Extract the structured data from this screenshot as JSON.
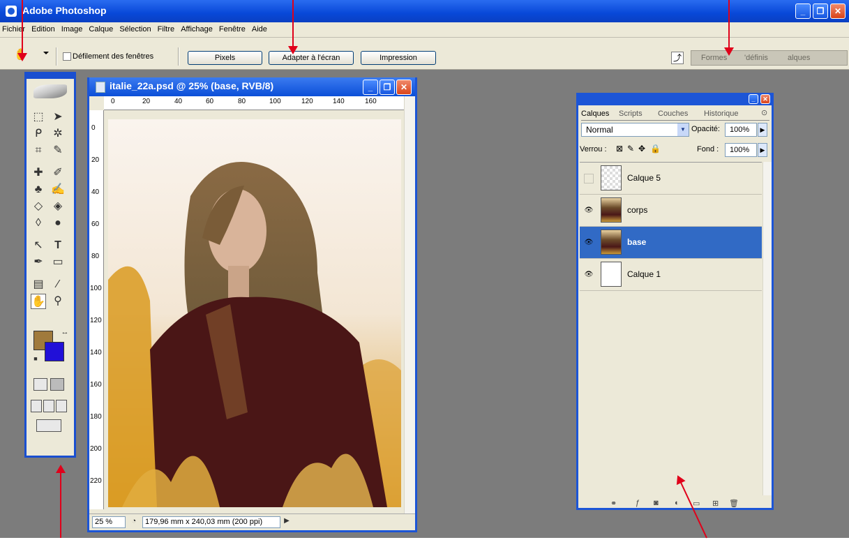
{
  "titlebar": {
    "title": "Adobe Photoshop"
  },
  "menu": [
    "Fichier",
    "Edition",
    "Image",
    "Calque",
    "Sélection",
    "Filtre",
    "Affichage",
    "Fenêtre",
    "Aide"
  ],
  "options": {
    "scroll_all_label": "Défilement des fenêtres",
    "btn_pixels": "Pixels",
    "btn_fit": "Adapter à l'écran",
    "btn_print": "Impression"
  },
  "palette_well": {
    "tabs": [
      "Formes",
      "'définis",
      "alques"
    ]
  },
  "document": {
    "title": "italie_22a.psd @ 25% (base, RVB/8)",
    "ruler_top": [
      "0",
      "20",
      "40",
      "60",
      "80",
      "100",
      "120",
      "140",
      "160"
    ],
    "ruler_left": [
      "0",
      "20",
      "40",
      "60",
      "80",
      "100",
      "120",
      "140",
      "160",
      "180",
      "200",
      "220"
    ],
    "zoom": "25 %",
    "status": "179,96 mm x 240,03 mm (200 ppi)"
  },
  "layers_panel": {
    "tabs": [
      "Calques",
      "Scripts",
      "Couches",
      "Historique"
    ],
    "blend_mode": "Normal",
    "opacity_label": "Opacité:",
    "opacity_value": "100%",
    "lock_label": "Verrou :",
    "fill_label": "Fond :",
    "fill_value": "100%",
    "layers": [
      {
        "name": "Calque 5",
        "visible": false,
        "thumb": "transparent"
      },
      {
        "name": "corps",
        "visible": true,
        "thumb": "person"
      },
      {
        "name": "base",
        "visible": true,
        "thumb": "person",
        "selected": true
      },
      {
        "name": "Calque 1",
        "visible": true,
        "thumb": "white"
      }
    ]
  },
  "colors": {
    "foreground": "#a07a3c",
    "background": "#2110d8",
    "accent": "#316ac5",
    "annotation": "#e0001a"
  }
}
